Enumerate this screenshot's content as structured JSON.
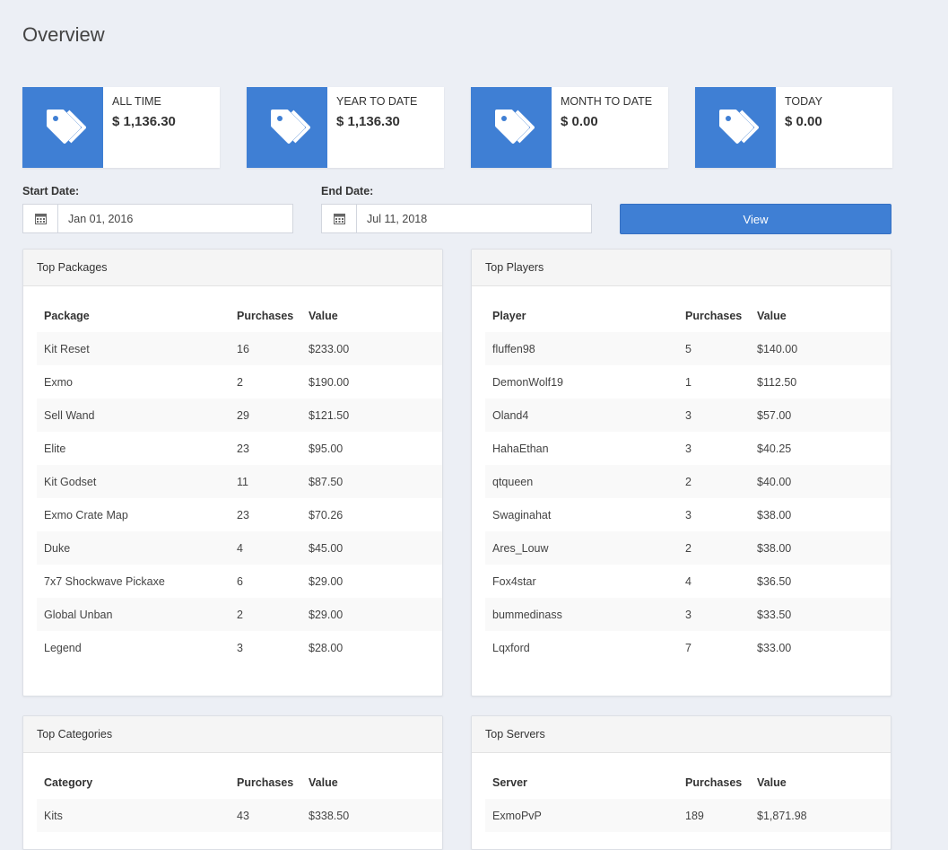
{
  "page": {
    "title": "Overview"
  },
  "stats": [
    {
      "label": "ALL TIME",
      "value": "$ 1,136.30",
      "icon": "tags-icon"
    },
    {
      "label": "YEAR TO DATE",
      "value": "$ 1,136.30",
      "icon": "tags-icon"
    },
    {
      "label": "MONTH TO DATE",
      "value": "$ 0.00",
      "icon": "tags-icon"
    },
    {
      "label": "TODAY",
      "value": "$ 0.00",
      "icon": "tags-icon"
    }
  ],
  "filters": {
    "start_label": "Start Date:",
    "start_value": "Jan 01, 2016",
    "end_label": "End Date:",
    "end_value": "Jul 11, 2018",
    "view_label": "View",
    "calendar_icon": "calendar-icon"
  },
  "colors": {
    "accent": "#3f7fd4",
    "background": "#eceff5"
  },
  "panels": {
    "packages": {
      "title": "Top Packages",
      "headers": [
        "Package",
        "Purchases",
        "Value"
      ],
      "rows": [
        [
          "Kit Reset",
          "16",
          "$233.00"
        ],
        [
          "Exmo",
          "2",
          "$190.00"
        ],
        [
          "Sell Wand",
          "29",
          "$121.50"
        ],
        [
          "Elite",
          "23",
          "$95.00"
        ],
        [
          "Kit Godset",
          "11",
          "$87.50"
        ],
        [
          "Exmo Crate Map",
          "23",
          "$70.26"
        ],
        [
          "Duke",
          "4",
          "$45.00"
        ],
        [
          "7x7 Shockwave Pickaxe",
          "6",
          "$29.00"
        ],
        [
          "Global Unban",
          "2",
          "$29.00"
        ],
        [
          "Legend",
          "3",
          "$28.00"
        ]
      ]
    },
    "players": {
      "title": "Top Players",
      "headers": [
        "Player",
        "Purchases",
        "Value"
      ],
      "rows": [
        [
          "fluffen98",
          "5",
          "$140.00"
        ],
        [
          "DemonWolf19",
          "1",
          "$112.50"
        ],
        [
          "Oland4",
          "3",
          "$57.00"
        ],
        [
          "HahaEthan",
          "3",
          "$40.25"
        ],
        [
          "qtqueen",
          "2",
          "$40.00"
        ],
        [
          "Swaginahat",
          "3",
          "$38.00"
        ],
        [
          "Ares_Louw",
          "2",
          "$38.00"
        ],
        [
          "Fox4star",
          "4",
          "$36.50"
        ],
        [
          "bummedinass",
          "3",
          "$33.50"
        ],
        [
          "Lqxford",
          "7",
          "$33.00"
        ]
      ]
    },
    "categories": {
      "title": "Top Categories",
      "headers": [
        "Category",
        "Purchases",
        "Value"
      ],
      "rows": [
        [
          "Kits",
          "43",
          "$338.50"
        ]
      ]
    },
    "servers": {
      "title": "Top Servers",
      "headers": [
        "Server",
        "Purchases",
        "Value"
      ],
      "rows": [
        [
          "ExmoPvP",
          "189",
          "$1,871.98"
        ]
      ]
    }
  }
}
